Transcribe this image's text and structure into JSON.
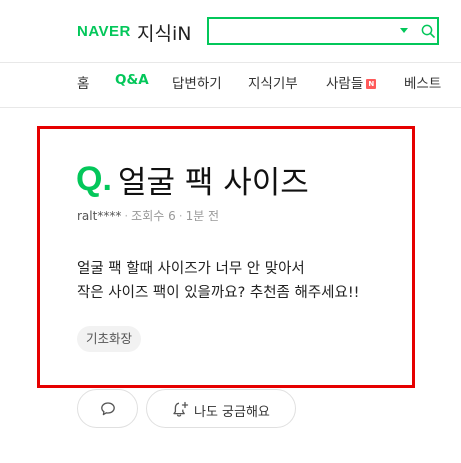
{
  "header": {
    "logo_naver": "NAVER",
    "logo_service": "지식iN",
    "search": {
      "value": "",
      "placeholder": ""
    }
  },
  "nav": {
    "tabs": [
      {
        "label": "홈",
        "active": false
      },
      {
        "label": "Q&A",
        "active": true
      },
      {
        "label": "답변하기",
        "active": false
      },
      {
        "label": "지식기부",
        "active": false
      },
      {
        "label": "사람들",
        "active": false,
        "badge": "N"
      },
      {
        "label": "베스트",
        "active": false
      }
    ]
  },
  "question": {
    "mark": "Q.",
    "title": "얼굴 팩 사이즈",
    "author": "ralt****",
    "views": "조회수 6",
    "time": "1분 전",
    "body_line1": "얼굴 팩 할때 사이즈가 너무 안 맞아서",
    "body_line2": "작은 사이즈 팩이 있을까요? 추천좀 해주세요!!",
    "tag": "기초화장"
  },
  "actions": {
    "curious_label": "나도 궁금해요"
  },
  "colors": {
    "brand_green": "#03c75a",
    "highlight_red": "#e60000",
    "badge_red": "#ff5a5a"
  },
  "icons": [
    "search-icon",
    "dropdown-caret-icon",
    "comment-icon",
    "bell-plus-icon"
  ]
}
